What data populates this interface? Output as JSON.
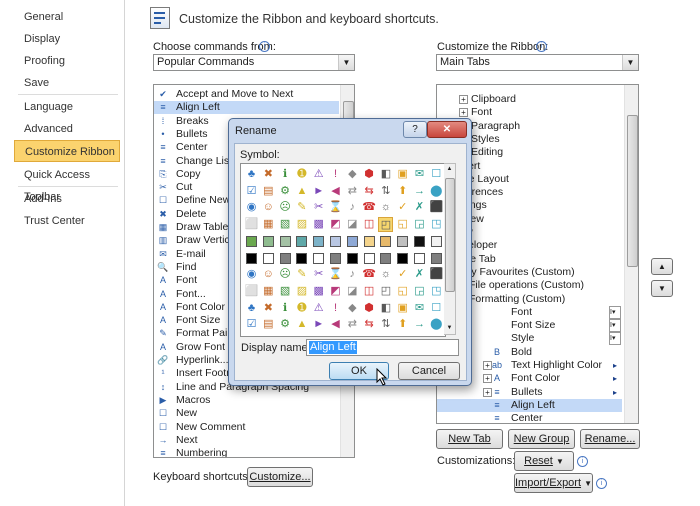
{
  "nav": {
    "items": [
      "General",
      "Display",
      "Proofing",
      "Save",
      "Language",
      "Advanced",
      "Customize Ribbon",
      "Quick Access Toolbar",
      "Add-Ins",
      "Trust Center"
    ],
    "active": "Customize Ribbon"
  },
  "header": {
    "title": "Customize the Ribbon and keyboard shortcuts."
  },
  "left": {
    "label": "Choose commands from:",
    "combo_value": "Popular Commands",
    "commands": [
      "Accept and Move to Next",
      "Align Left",
      "Breaks",
      "Bullets",
      "Center",
      "Change List",
      "Copy",
      "Cut",
      "Define New",
      "Delete",
      "Draw Table",
      "Draw Vertical",
      "E-mail",
      "Find",
      "Font",
      "Font...",
      "Font Color",
      "Font Size",
      "Format Painter",
      "Grow Font",
      "Hyperlink...",
      "Insert Footnote",
      "Line and Paragraph Spacing",
      "Macros",
      "New",
      "New Comment",
      "Next",
      "Numbering"
    ]
  },
  "right": {
    "label": "Customize the Ribbon:",
    "combo_value": "Main Tabs",
    "tree": [
      {
        "text": "Clipboard",
        "expander": "+"
      },
      {
        "text": "Font",
        "expander": "+"
      },
      {
        "text": "Paragraph",
        "expander": "+"
      },
      {
        "text": "Styles",
        "expander": "+"
      },
      {
        "text": "Editing",
        "expander": "+"
      },
      {
        "text": "nsert",
        "expander": "+"
      },
      {
        "text": "age Layout",
        "expander": "+"
      },
      {
        "text": "eferences",
        "expander": "+"
      },
      {
        "text": "ailings",
        "expander": "+"
      },
      {
        "text": "eview",
        "expander": "+"
      },
      {
        "text": "iew",
        "expander": "+"
      },
      {
        "text": "eveloper",
        "expander": "+"
      },
      {
        "text": "ffice Tab",
        "expander": "+"
      },
      {
        "text": "ly Favourites (Custom)",
        "expander": "-"
      },
      {
        "text": "File operations (Custom)",
        "expander": "+"
      },
      {
        "text": "Formatting (Custom)",
        "expander": "-"
      },
      {
        "text": "Font",
        "expander": ""
      },
      {
        "text": "Font Size",
        "expander": ""
      },
      {
        "text": "Style",
        "expander": ""
      },
      {
        "text": "Bold",
        "expander": ""
      },
      {
        "text": "Text Highlight Color",
        "expander": "+"
      },
      {
        "text": "Font Color",
        "expander": "+"
      },
      {
        "text": "Bullets",
        "expander": "+"
      },
      {
        "text": "Align Left",
        "expander": ""
      },
      {
        "text": "Center",
        "expander": ""
      }
    ],
    "selected": "Align Left",
    "new_tab": "New Tab",
    "new_group": "New Group",
    "rename": "Rename...",
    "customizations_label": "Customizations:",
    "reset": "Reset",
    "import_export": "Import/Export"
  },
  "keyboard": {
    "label": "Keyboard shortcuts:",
    "button": "Customize..."
  },
  "dialog": {
    "title": "Rename",
    "help": "?",
    "close": "✕",
    "symbol_label": "Symbol:",
    "display_name_label": "Display name:",
    "display_name_value": "Align Left",
    "ok": "OK",
    "cancel": "Cancel"
  },
  "colors": {
    "nav_active": "#fbd36e",
    "selection": "#c3d9f7",
    "dialog_bg": "#c9d8ee",
    "close_btn": "#c8463d"
  }
}
